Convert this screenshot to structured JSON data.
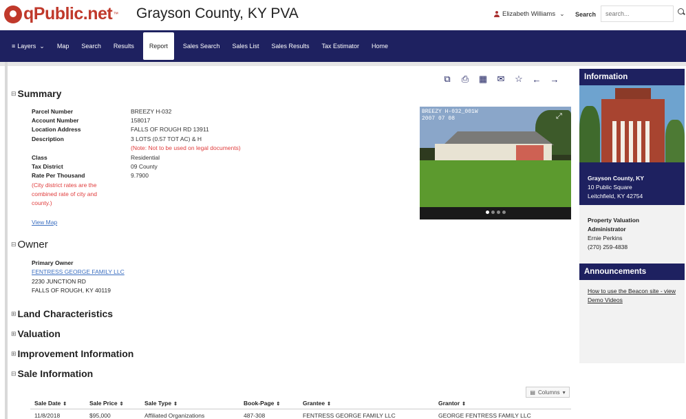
{
  "header": {
    "brand": "qPublic.net",
    "brand_tm": "™",
    "county_title": "Grayson County, KY PVA",
    "user_name": "Elizabeth Williams",
    "search_label": "Search",
    "search_placeholder": "search..."
  },
  "nav": {
    "items": [
      {
        "label": "Layers",
        "has_dropdown": true
      },
      {
        "label": "Map"
      },
      {
        "label": "Search"
      },
      {
        "label": "Results"
      },
      {
        "label": "Report",
        "active": true
      },
      {
        "label": "Sales Search"
      },
      {
        "label": "Sales List"
      },
      {
        "label": "Sales Results"
      },
      {
        "label": "Tax Estimator"
      },
      {
        "label": "Home"
      }
    ]
  },
  "toolbar": {
    "icons": [
      "share-icon",
      "print-icon",
      "image-icon",
      "email-icon",
      "star-icon",
      "arrow-left-icon",
      "arrow-right-icon"
    ]
  },
  "summary": {
    "heading": "Summary",
    "parcel_number_label": "Parcel Number",
    "parcel_number": "BREEZY H-032",
    "account_number_label": "Account Number",
    "account_number": "158017",
    "location_address_label": "Location Address",
    "location_address": "FALLS OF ROUGH RD 13911",
    "description_label": "Description",
    "description": "3 LOTS (0.57 TOT AC) & H",
    "description_note": "(Note: Not to be used on legal documents)",
    "class_label": "Class",
    "class_value": "Residential",
    "tax_district_label": "Tax District",
    "tax_district": "09 County",
    "rate_label": "Rate Per Thousand",
    "rate_value": "9.7900",
    "rate_note_1": "(City district rates are the",
    "rate_note_2": "combined rate of city and",
    "rate_note_3": "county.)",
    "view_map": "View Map"
  },
  "photo": {
    "caption_1": "BREEZY H-032_001W",
    "caption_2": "2007 07 08"
  },
  "owner": {
    "heading": "Owner",
    "primary_owner_label": "Primary Owner",
    "owner_name": "FENTRESS GEORGE FAMILY LLC",
    "address_1": "2230 JUNCTION RD",
    "address_2": "FALLS OF ROUGH, KY 40119"
  },
  "sections": {
    "land": "Land Characteristics",
    "valuation": "Valuation",
    "improvement": "Improvement Information",
    "sale": "Sale Information"
  },
  "sidebar": {
    "info_heading": "Information",
    "county_name": "Grayson County, KY",
    "street": "10 Public Square",
    "city": "Leitchfield, KY 42754",
    "pva_title_1": "Property Valuation",
    "pva_title_2": "Administrator",
    "pva_name": "Ernie Perkins",
    "pva_phone": "(270) 259-4838",
    "announcements_heading": "Announcements",
    "announce_link_1": "How to use the Beacon site - view",
    "announce_link_2": "Demo Videos"
  },
  "sale_table": {
    "columns_button": "Columns",
    "headers": [
      "Sale Date",
      "Sale Price",
      "Sale Type",
      "Book-Page",
      "Grantee",
      "Grantor"
    ],
    "row": [
      "11/8/2018",
      "$95,000",
      "Affiliated Organizations",
      "487-308",
      "FENTRESS GEORGE FAMILY LLC",
      "GEORGE FENTRESS FAMILY LLC"
    ]
  }
}
